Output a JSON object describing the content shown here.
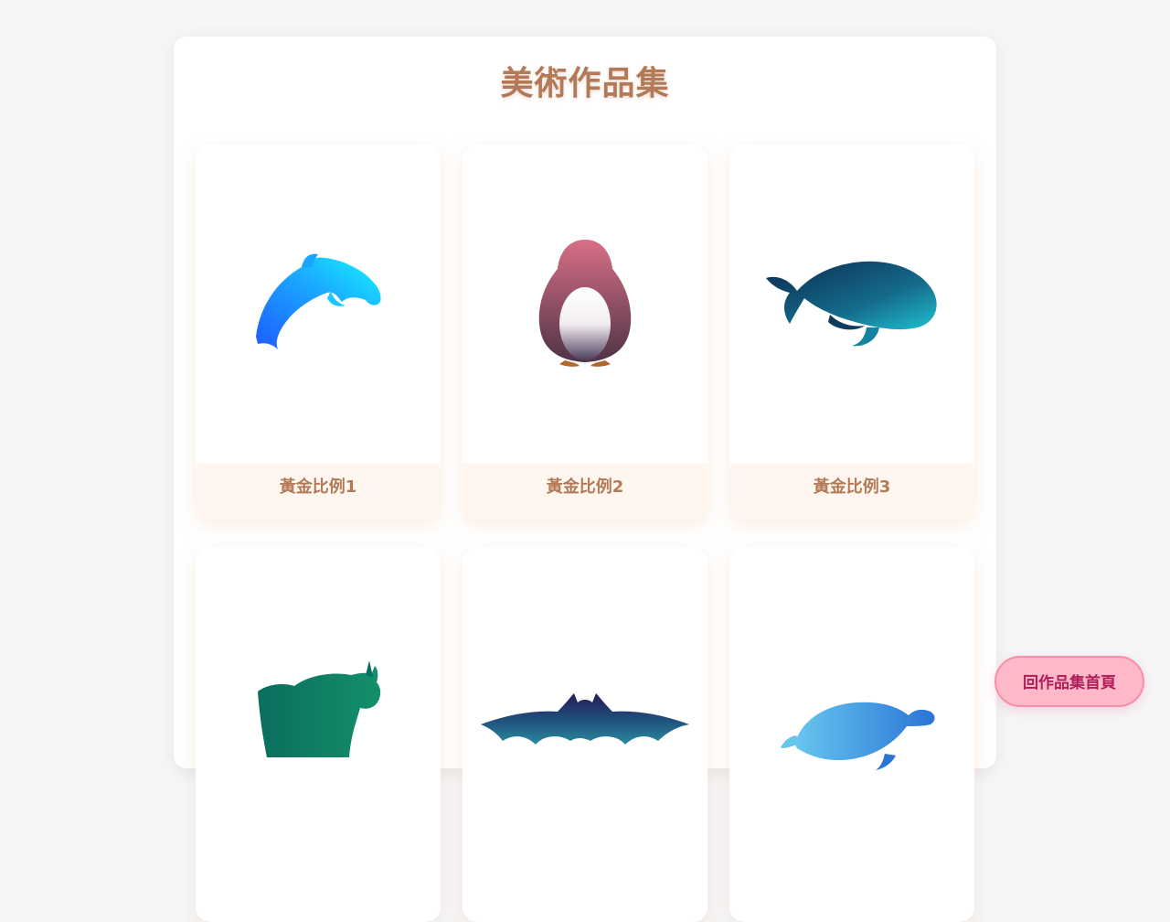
{
  "page": {
    "title": "美術作品集"
  },
  "gallery": {
    "items": [
      {
        "caption": "黃金比例1",
        "icon": "dolphin-icon"
      },
      {
        "caption": "黃金比例2",
        "icon": "penguin-icon"
      },
      {
        "caption": "黃金比例3",
        "icon": "whale-icon"
      },
      {
        "caption": "",
        "icon": "rhino-icon"
      },
      {
        "caption": "",
        "icon": "bat-icon"
      },
      {
        "caption": "",
        "icon": "turtle-icon"
      }
    ]
  },
  "nav": {
    "home_label": "回作品集首頁"
  },
  "colors": {
    "accent": "#b47a58",
    "caption_bg": "#fff6ef",
    "button_bg": "#ffb8c8",
    "button_text": "#b01e5a"
  }
}
